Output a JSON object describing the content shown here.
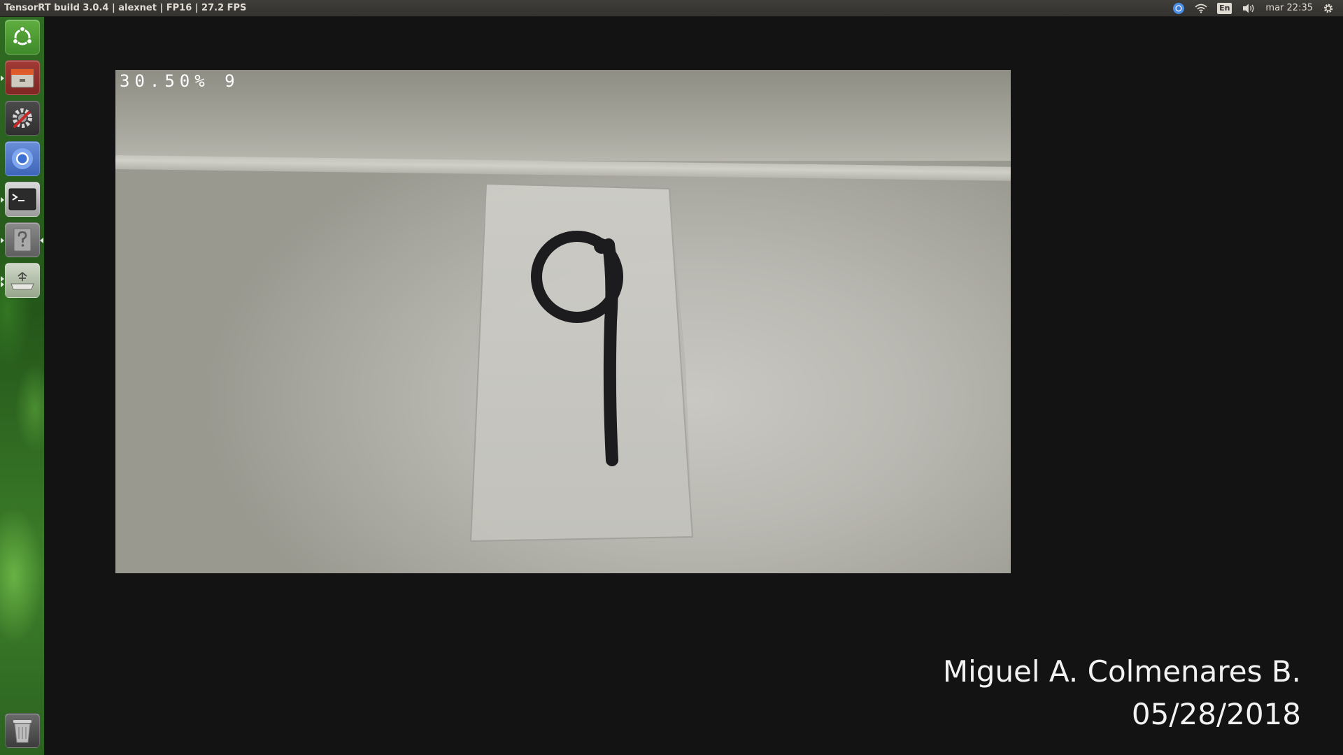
{
  "top_panel": {
    "window_title": "TensorRT build 3.0.4 | alexnet | FP16 | 27.2 FPS",
    "keyboard_layout": "En",
    "clock": "mar 22:35",
    "indicator_icons": [
      "chromium-indicator-icon",
      "wifi-icon",
      "keyboard-layout-icon",
      "volume-icon",
      "gear-icon"
    ]
  },
  "launcher": {
    "items": [
      {
        "name": "ubuntu-dash-icon"
      },
      {
        "name": "file-manager-icon"
      },
      {
        "name": "system-settings-icon"
      },
      {
        "name": "chromium-icon"
      },
      {
        "name": "terminal-icon"
      },
      {
        "name": "help-icon"
      },
      {
        "name": "usb-drive-icon"
      },
      {
        "name": "trash-icon"
      }
    ]
  },
  "camera": {
    "overlay": "30.50% 9",
    "digit_on_paper": "9"
  },
  "credits": {
    "author": "Miguel A. Colmenares B.",
    "date": "05/28/2018"
  },
  "colors": {
    "panel_bg": "#3c3b37",
    "desktop_bg": "#131313",
    "launcher_green": "#2f6b22",
    "overlay_text": "#ffffff"
  }
}
